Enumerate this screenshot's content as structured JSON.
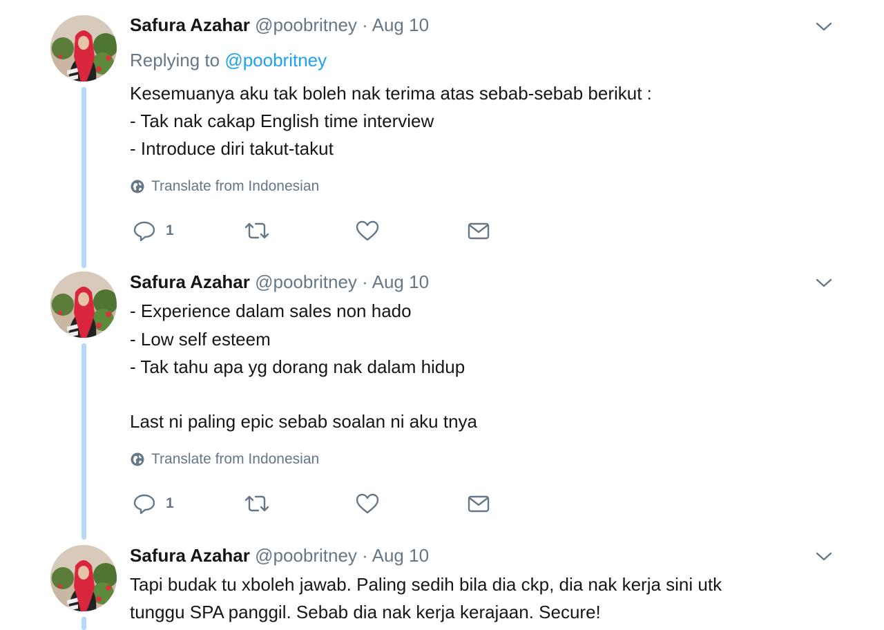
{
  "colors": {
    "thread_line": "#b5d9f6",
    "link": "#1da1f2",
    "muted": "#657786",
    "text": "#14171a"
  },
  "tweets": [
    {
      "author": {
        "name": "Safura Azahar",
        "handle": "@poobritney",
        "avatar_icon": "profile-photo"
      },
      "separator": "·",
      "date": "Aug 10",
      "replying": {
        "prefix": "Replying to",
        "mention": "@poobritney"
      },
      "lines": [
        "Kesemuanya aku tak boleh nak terima atas sebab-sebab berikut :",
        "- Tak nak cakap English time interview",
        "- Introduce diri takut-takut"
      ],
      "translate_label": "Translate from Indonesian",
      "actions": {
        "reply_count": "1",
        "reply_icon": "reply-icon",
        "retweet_icon": "retweet-icon",
        "like_icon": "heart-icon",
        "dm_icon": "envelope-icon"
      },
      "menu_icon": "chevron-down-icon"
    },
    {
      "author": {
        "name": "Safura Azahar",
        "handle": "@poobritney",
        "avatar_icon": "profile-photo"
      },
      "separator": "·",
      "date": "Aug 10",
      "lines": [
        "- Experience dalam sales non hado",
        "- Low self esteem",
        "- Tak tahu apa yg dorang nak dalam hidup",
        "",
        "Last ni paling epic sebab soalan ni aku tnya"
      ],
      "translate_label": "Translate from Indonesian",
      "actions": {
        "reply_count": "1",
        "reply_icon": "reply-icon",
        "retweet_icon": "retweet-icon",
        "like_icon": "heart-icon",
        "dm_icon": "envelope-icon"
      },
      "menu_icon": "chevron-down-icon"
    },
    {
      "author": {
        "name": "Safura Azahar",
        "handle": "@poobritney",
        "avatar_icon": "profile-photo"
      },
      "separator": "·",
      "date": "Aug 10",
      "lines": [
        "Tapi budak tu xboleh jawab. Paling sedih bila dia ckp, dia nak kerja sini utk",
        "tunggu SPA panggil. Sebab dia nak kerja kerajaan. Secure!"
      ],
      "menu_icon": "chevron-down-icon"
    }
  ]
}
